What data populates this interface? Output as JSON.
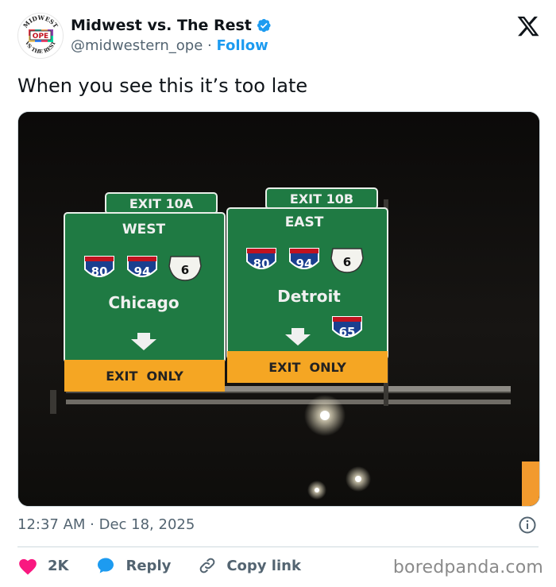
{
  "account": {
    "display_name": "Midwest vs. The Rest",
    "handle": "@midwestern_ope",
    "separator": "·",
    "follow_label": "Follow",
    "avatar": {
      "top_text": "MIDWEST",
      "bottom_text": "VS THE REST",
      "center_text": "OPE"
    },
    "verified_color": "#1d9bf0"
  },
  "tweet": {
    "text": "When you see this it’s too late",
    "timestamp": "12:37 AM · Dec 18, 2025"
  },
  "photo": {
    "left_sign": {
      "exit": "EXIT 10A",
      "direction": "WEST",
      "shields": [
        "80",
        "94",
        "6"
      ],
      "city": "Chicago",
      "banner": "EXIT  ONLY"
    },
    "right_sign": {
      "exit": "EXIT 10B",
      "direction": "EAST",
      "shields": [
        "80",
        "94",
        "6",
        "65"
      ],
      "city": "Detroit",
      "banner": "EXIT  ONLY"
    },
    "sign_color": "#1f7a43",
    "banner_color": "#f5a623"
  },
  "actions": {
    "like_count": "2K",
    "reply_label": "Reply",
    "copy_link_label": "Copy link",
    "like_color": "#f91880",
    "reply_color": "#1d9bf0"
  },
  "watermark": "boredpanda.com"
}
